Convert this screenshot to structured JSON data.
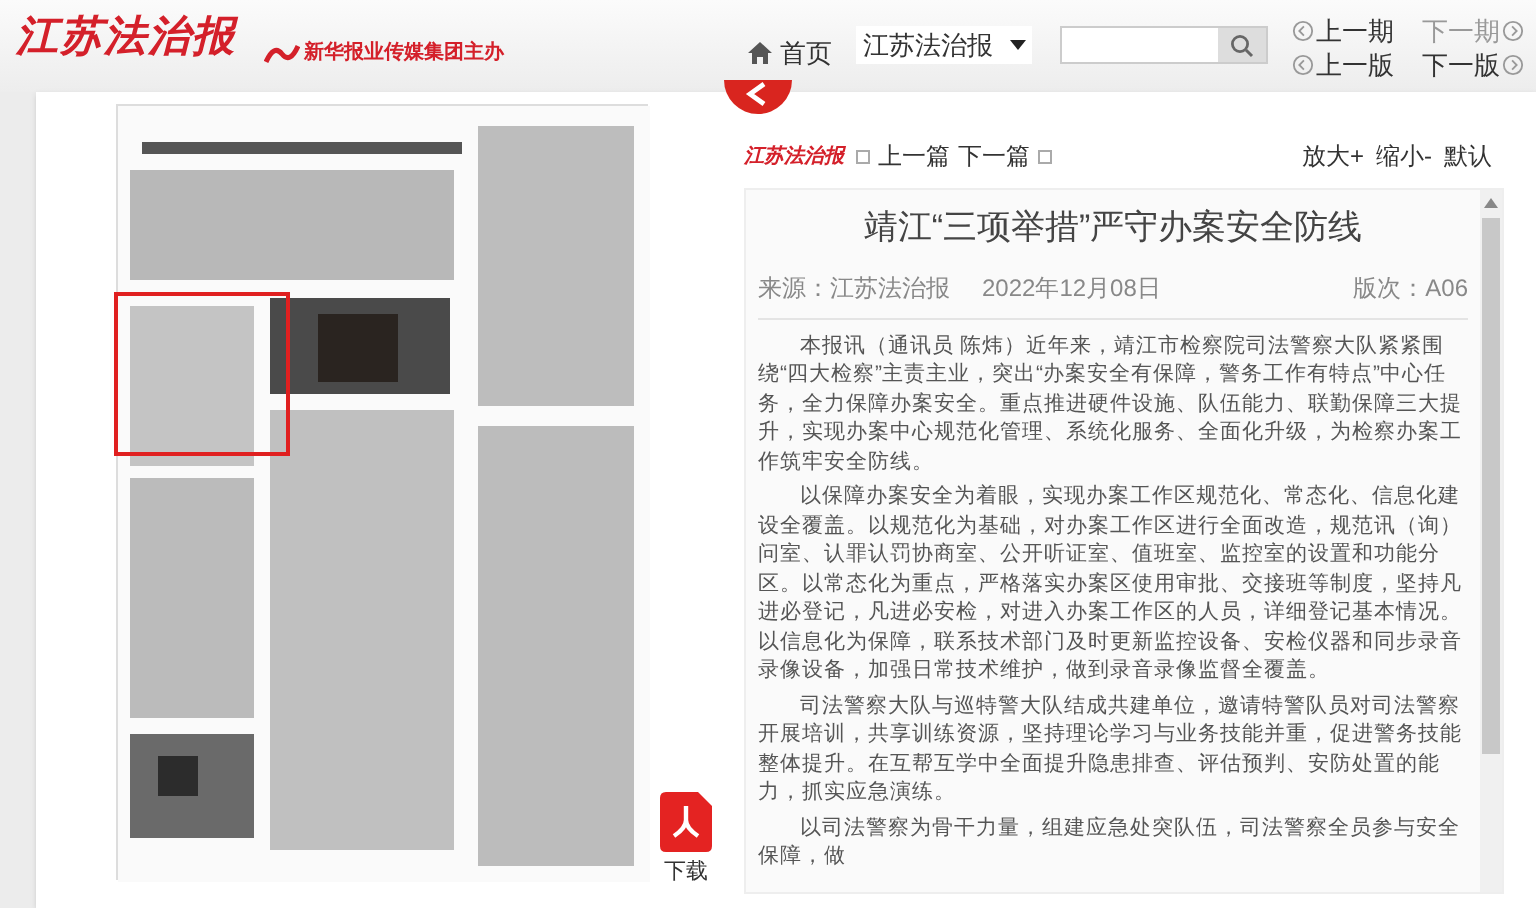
{
  "header": {
    "logo_text": "江苏法治报",
    "publisher": "新华报业传媒集团主办",
    "home": "首页",
    "paper_select": "江苏法治报",
    "nav": [
      {
        "label": "上一期",
        "kind": "prev",
        "disabled": false
      },
      {
        "label": "下一期",
        "kind": "next",
        "disabled": true
      },
      {
        "label": "上一版",
        "kind": "prev",
        "disabled": false
      },
      {
        "label": "下一版",
        "kind": "next",
        "disabled": false
      }
    ]
  },
  "page_viewer": {
    "download": "下载"
  },
  "article": {
    "logo_text": "江苏法治报",
    "prev": "上一篇",
    "next": "下一篇",
    "zoom": [
      "放大+",
      "缩小-",
      "默认"
    ],
    "title": "靖江“三项举措”严守办案安全防线",
    "source": "来源：江苏法治报",
    "date": "2022年12月08日",
    "edition": "版次：A06",
    "paragraphs": [
      "本报讯（通讯员 陈炜）近年来，靖江市检察院司法警察大队紧紧围绕“四大检察”主责主业，突出“办案安全有保障，警务工作有特点”中心任务，全力保障办案安全。重点推进硬件设施、队伍能力、联勤保障三大提升，实现办案中心规范化管理、系统化服务、全面化升级，为检察办案工作筑牢安全防线。",
      "以保障办案安全为着眼，实现办案工作区规范化、常态化、信息化建设全覆盖。以规范化为基础，对办案工作区进行全面改造，规范讯（询）问室、认罪认罚协商室、公开听证室、值班室、监控室的设置和功能分区。以常态化为重点，严格落实办案区使用审批、交接班等制度，坚持凡进必登记，凡进必安检，对进入办案工作区的人员，详细登记基本情况。以信息化为保障，联系技术部门及时更新监控设备、安检仪器和同步录音录像设备，加强日常技术维护，做到录音录像监督全覆盖。",
      "司法警察大队与巡特警大队结成共建单位，邀请特警队员对司法警察开展培训，共享训练资源，坚持理论学习与业务技能并重，促进警务技能整体提升。在互帮互学中全面提升隐患排查、评估预判、安防处置的能力，抓实应急演练。",
      "以司法警察为骨干力量，组建应急处突队伍，司法警察全员参与安全保障，做"
    ]
  }
}
